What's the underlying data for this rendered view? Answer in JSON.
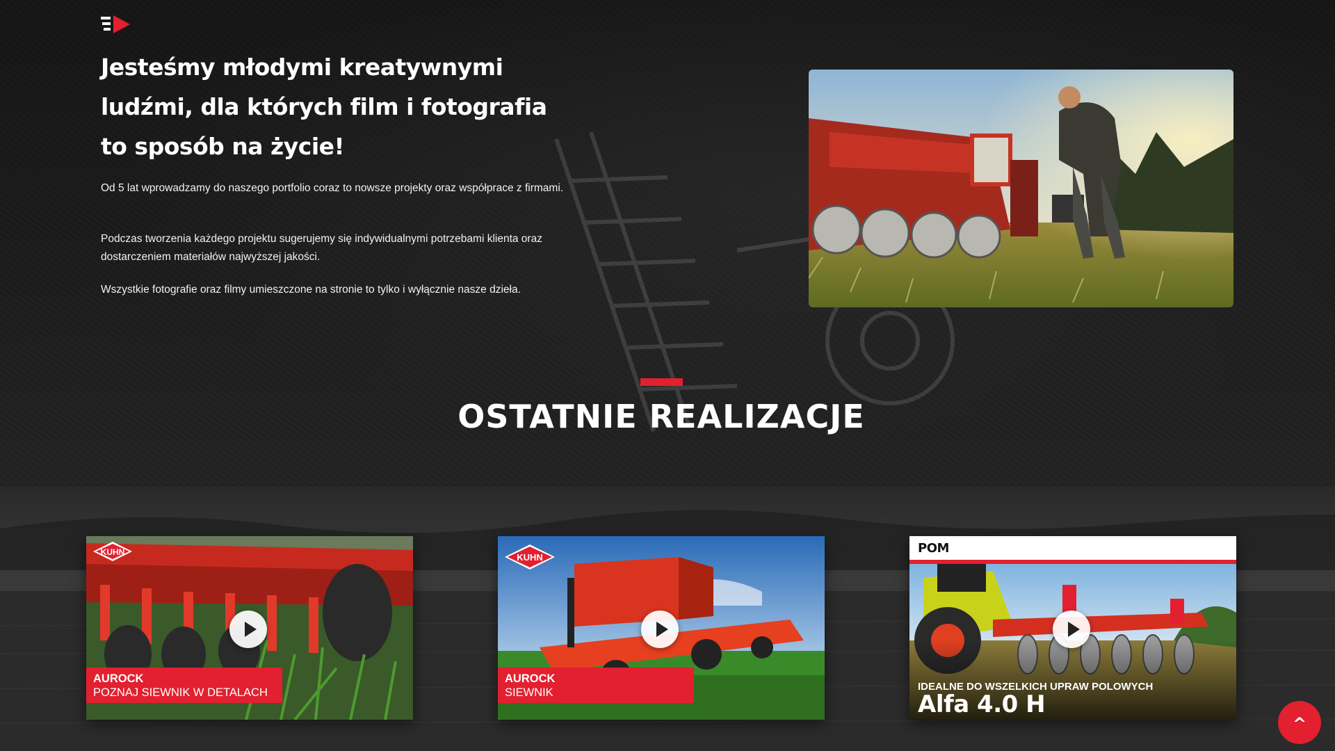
{
  "brand": {
    "logo_icon": "play-arrow-logo-icon",
    "accent": "#e2202f"
  },
  "about": {
    "headline": "Jesteśmy młodymi kreatywnymi ludźmi, dla których film i fotografia to sposób na życie!",
    "paragraphs": [
      "Od 5 lat wprowadzamy do naszego portfolio coraz to nowsze projekty oraz współprace z firmami.",
      "Podczas tworzenia każdego projektu sugerujemy się indywidualnymi potrzebami klienta oraz dostarczeniem materiałów najwyższej jakości.",
      "Wszystkie fotografie oraz filmy umieszczone na stronie to tylko i wyłącznie nasze dzieła."
    ]
  },
  "realizations": {
    "title": "OSTATNIE REALIZACJE",
    "videos": [
      {
        "brand_logo": "KUHN",
        "caption_line1": "AUROCK",
        "caption_line2": "POZNAJ SIEWNIK W DETALACH"
      },
      {
        "brand_logo": "KUHN",
        "caption_line1": "AUROCK",
        "caption_line2": "SIEWNIK"
      },
      {
        "brand_logo": "POM",
        "tagline": "IDEALNE DO WSZELKICH UPRAW POLOWYCH",
        "model": "Alfa 4.0 H"
      }
    ]
  },
  "scroll_top": {
    "label": "^",
    "icon": "chevron-up-icon"
  }
}
